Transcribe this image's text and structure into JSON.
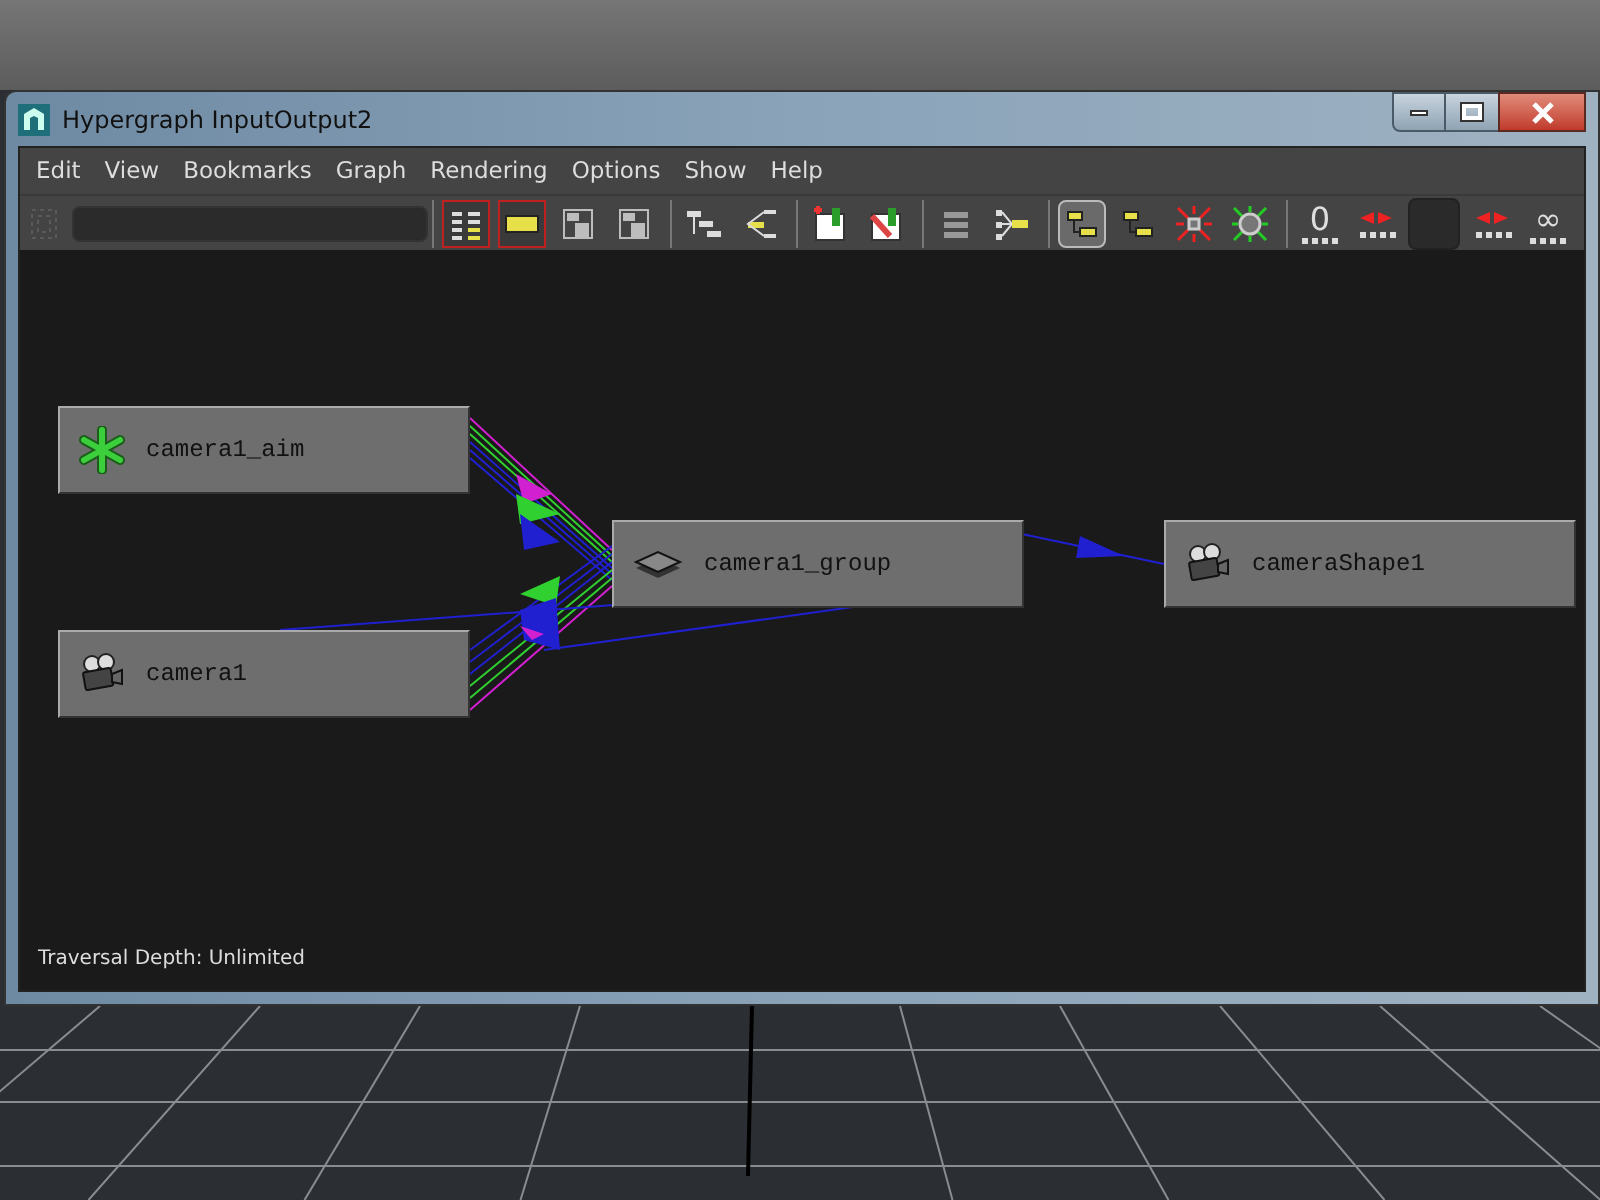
{
  "window": {
    "title": "Hypergraph InputOutput2"
  },
  "menu": [
    "Edit",
    "View",
    "Bookmarks",
    "Graph",
    "Rendering",
    "Options",
    "Show",
    "Help"
  ],
  "toolbar": [
    [
      {
        "kind": "frame-all",
        "highlighted": true,
        "pressed": false
      },
      {
        "kind": "frame-selection",
        "highlighted": true,
        "pressed": false
      },
      {
        "kind": "tree-a",
        "highlighted": false,
        "pressed": false
      },
      {
        "kind": "tree-b",
        "highlighted": false,
        "pressed": false
      }
    ],
    [
      {
        "kind": "branch",
        "highlighted": false,
        "pressed": false
      },
      {
        "kind": "branch-left",
        "highlighted": false,
        "pressed": false
      }
    ],
    [
      {
        "kind": "bookmark-add",
        "highlighted": false,
        "pressed": false
      },
      {
        "kind": "bookmark-edit",
        "highlighted": false,
        "pressed": false
      }
    ],
    [
      {
        "kind": "list",
        "highlighted": false,
        "pressed": false
      },
      {
        "kind": "fan",
        "highlighted": false,
        "pressed": false
      }
    ],
    [
      {
        "kind": "steps",
        "highlighted": false,
        "pressed": true
      },
      {
        "kind": "steps",
        "highlighted": false,
        "pressed": false
      },
      {
        "kind": "collapse",
        "highlighted": false,
        "pressed": false
      },
      {
        "kind": "expand",
        "highlighted": false,
        "pressed": false
      }
    ],
    [
      {
        "kind": "depth",
        "highlighted": false,
        "pressed": false,
        "text": "0"
      },
      {
        "kind": "shrink",
        "highlighted": false,
        "pressed": false
      },
      {
        "kind": "blank",
        "highlighted": false,
        "pressed": false
      },
      {
        "kind": "grow",
        "highlighted": false,
        "pressed": false
      },
      {
        "kind": "depth",
        "highlighted": false,
        "pressed": false,
        "text": "∞"
      }
    ]
  ],
  "nodes": [
    {
      "label": "camera1_aim",
      "kind": "locator"
    },
    {
      "label": "camera1",
      "kind": "camera"
    },
    {
      "label": "camera1_group",
      "kind": "group"
    },
    {
      "label": "cameraShape1",
      "kind": "camera"
    }
  ],
  "status": "Traversal Depth: Unlimited"
}
